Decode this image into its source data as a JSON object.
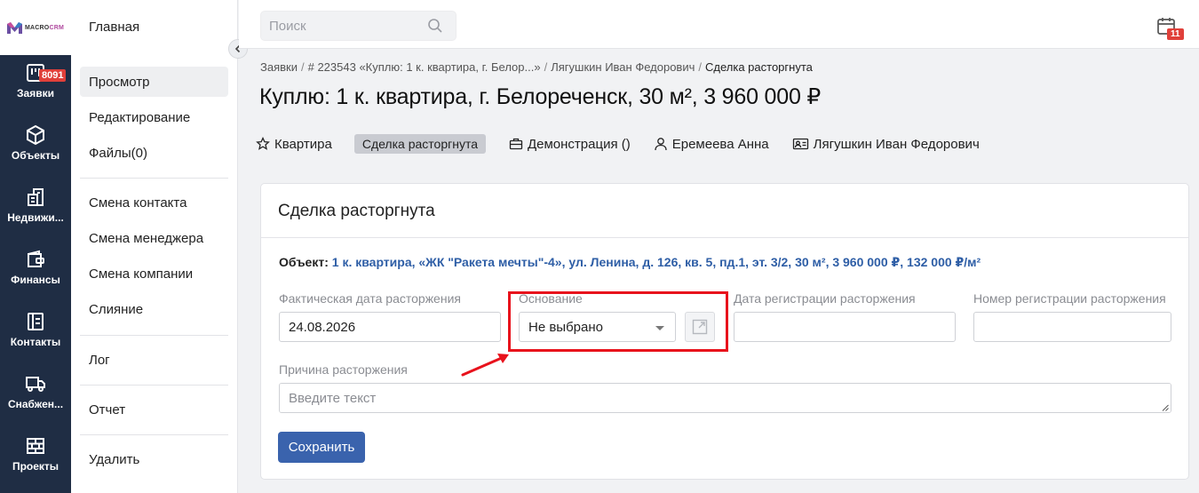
{
  "logo": {
    "brand_prefix": "MACRO",
    "brand_suffix": "CRM"
  },
  "rail": {
    "items": [
      {
        "label": "Заявки",
        "badge": "8091",
        "icon": "kanban-icon"
      },
      {
        "label": "Объекты",
        "icon": "cube-icon"
      },
      {
        "label": "Недвижи...",
        "icon": "building-icon"
      },
      {
        "label": "Финансы",
        "icon": "wallet-icon"
      },
      {
        "label": "Контакты",
        "icon": "contacts-icon"
      },
      {
        "label": "Снабжен...",
        "icon": "truck-icon"
      },
      {
        "label": "Проекты",
        "icon": "bricks-icon"
      }
    ]
  },
  "sidebar": {
    "title": "Главная",
    "items": [
      {
        "label": "Просмотр",
        "active": true
      },
      {
        "label": "Редактирование"
      },
      {
        "label": "Файлы(0)"
      },
      {
        "label": "Смена контакта"
      },
      {
        "label": "Смена менеджера"
      },
      {
        "label": "Смена компании"
      },
      {
        "label": "Слияние"
      },
      {
        "label": "Лог"
      },
      {
        "label": "Отчет"
      },
      {
        "label": "Удалить"
      }
    ]
  },
  "topbar": {
    "search_placeholder": "Поиск",
    "calendar_badge": "11"
  },
  "breadcrumb": {
    "items": [
      "Заявки",
      "# 223543 «Куплю: 1 к. квартира, г. Белор...»",
      "Лягушкин Иван Федорович",
      "Сделка расторгнута"
    ]
  },
  "page": {
    "title": "Куплю: 1 к. квартира, г. Белореченск, 30 м², 3 960 000 ₽"
  },
  "tags": {
    "type": "Квартира",
    "status": "Сделка расторгнута",
    "demo": "Демонстрация ()",
    "agent": "Еремеева Анна",
    "client": "Лягушкин Иван Федорович"
  },
  "card": {
    "title": "Сделка расторгнута",
    "object_label": "Объект:",
    "object_value": "1 к. квартира, «ЖК \"Ракета мечты\"-4», ул. Ленина, д. 126, кв. 5, пд.1, эт. 3/2, 30 м², 3 960 000 ₽, 132 000 ₽/м²",
    "fields": {
      "actual_date_label": "Фактическая дата расторжения",
      "actual_date_value": "24.08.2026",
      "basis_label": "Основание",
      "basis_value": "Не выбрано",
      "reg_date_label": "Дата регистрации расторжения",
      "reg_date_value": "",
      "reg_number_label": "Номер регистрации расторжения",
      "reg_number_value": "",
      "reason_label": "Причина расторжения",
      "reason_placeholder": "Введите текст"
    },
    "save_label": "Сохранить"
  },
  "colors": {
    "rail_bg": "#1f2d44",
    "accent": "#3a63ad",
    "link": "#2e5ea6",
    "badge": "#e0403a",
    "annotation": "#e8121c"
  }
}
